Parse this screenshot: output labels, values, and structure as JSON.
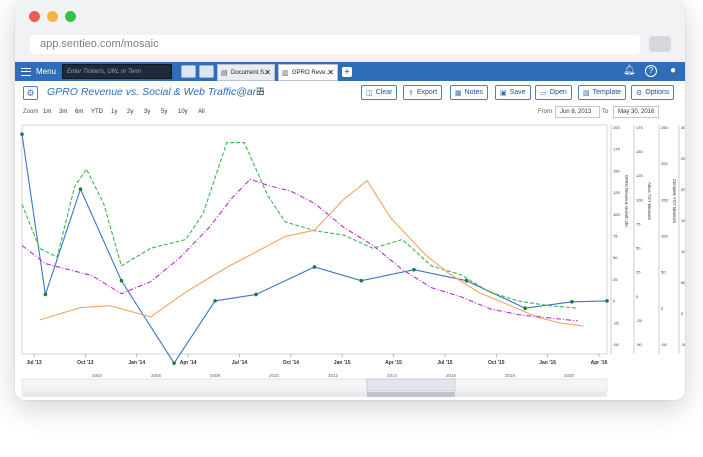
{
  "browser": {
    "url": "app.sentieo.com/mosaic",
    "dots": [
      "#ee5b52",
      "#f5b43f",
      "#38c14a"
    ]
  },
  "appbar": {
    "menu_label": "Menu",
    "ticker_placeholder": "Enter Ticker/s, URL or Term",
    "tabs": [
      {
        "label": "Document S..",
        "icon": "document-icon"
      },
      {
        "label": "GPRO Reve..",
        "icon": "chart-icon"
      }
    ],
    "new_tab_label": "+",
    "icons": [
      "bell-icon",
      "help-icon",
      "user-icon"
    ]
  },
  "toolbar": {
    "title": "GPRO Revenue vs. Social & Web Traffic@arib",
    "buttons": [
      {
        "label": "Clear",
        "icon": "clear-icon"
      },
      {
        "label": "Export",
        "icon": "export-icon"
      },
      {
        "label": "Notes",
        "icon": "notes-icon"
      },
      {
        "label": "Save",
        "icon": "save-icon"
      },
      {
        "label": "Open",
        "icon": "folder-icon"
      },
      {
        "label": "Template",
        "icon": "template-icon"
      },
      {
        "label": "Options",
        "icon": "gear-icon"
      }
    ]
  },
  "zoom": {
    "label": "Zoom",
    "options": [
      "1m",
      "3m",
      "6m",
      "YTD",
      "1y",
      "2y",
      "3y",
      "5y",
      "10y",
      "All"
    ],
    "from_label": "From",
    "from_value": "Jun 8, 2013",
    "to_label": "To",
    "to_value": "May 30, 2016"
  },
  "chart_data": {
    "type": "line",
    "x_ticks": [
      "Jul '13",
      "Oct '13",
      "Jan '14",
      "Apr '14",
      "Jul '14",
      "Oct '14",
      "Jan '15",
      "Apr '15",
      "Jul '15",
      "Oct '15",
      "Jan '16",
      "Apr '16"
    ],
    "navigator_ticks": [
      "2004",
      "2006",
      "2008",
      "2010",
      "2012",
      "2014",
      "2016",
      "2018",
      "2020"
    ],
    "axes": [
      {
        "label": "GPRO Revenue Growth.cbv",
        "ticks": [
          "200",
          "175",
          "150",
          "125",
          "100",
          "75",
          "50",
          "25",
          "0",
          "-25",
          "-50"
        ],
        "range": [
          -50,
          200
        ]
      },
      {
        "label": "Alexa YOY Measure",
        "ticks": [
          "175",
          "150",
          "125",
          "100",
          "75",
          "50",
          "25",
          "0",
          "-25",
          "-50"
        ],
        "range": [
          -60,
          200
        ]
      },
      {
        "label": "Compete YOY Measure",
        "ticks": [
          "250",
          "200",
          "150",
          "100",
          "50",
          "0",
          "-50"
        ],
        "range": [
          -70,
          300
        ]
      },
      {
        "label": "Twitter Mentions YOY Measure",
        "ticks": [
          "300",
          "250",
          "200",
          "150",
          "100",
          "50",
          "0",
          "-50"
        ],
        "range": [
          -60,
          320
        ]
      }
    ],
    "series": [
      {
        "name": "GPRO Revenue Growth.cbv",
        "color": "#3a78c4",
        "style": "solid-markers",
        "axis": 0,
        "points": [
          [
            0,
            190
          ],
          [
            0.4,
            15
          ],
          [
            1.0,
            130
          ],
          [
            1.7,
            30
          ],
          [
            2.6,
            -60
          ],
          [
            3.3,
            8
          ],
          [
            4.0,
            15
          ],
          [
            5.0,
            45
          ],
          [
            5.8,
            30
          ],
          [
            6.7,
            42
          ],
          [
            7.6,
            30
          ],
          [
            8.6,
            0
          ],
          [
            9.4,
            7
          ],
          [
            10.0,
            8
          ]
        ]
      },
      {
        "name": "Alexa YOY Measure",
        "color": "#3bb84b",
        "style": "dashed",
        "axis": 1,
        "points": [
          [
            0,
            110
          ],
          [
            0.3,
            60
          ],
          [
            0.6,
            50
          ],
          [
            0.9,
            130
          ],
          [
            1.1,
            150
          ],
          [
            1.4,
            110
          ],
          [
            1.7,
            40
          ],
          [
            2.2,
            60
          ],
          [
            2.8,
            70
          ],
          [
            3.1,
            100
          ],
          [
            3.5,
            180
          ],
          [
            3.8,
            180
          ],
          [
            4.2,
            120
          ],
          [
            4.5,
            90
          ],
          [
            5.0,
            80
          ],
          [
            5.5,
            75
          ],
          [
            6.0,
            60
          ],
          [
            6.5,
            70
          ],
          [
            7.0,
            40
          ],
          [
            7.5,
            30
          ],
          [
            8.0,
            10
          ],
          [
            8.5,
            0
          ],
          [
            9.0,
            -5
          ],
          [
            9.5,
            -8
          ]
        ]
      },
      {
        "name": "Compete YOY Measure",
        "color": "#f5a462",
        "style": "solid",
        "axis": 2,
        "points": [
          [
            0.3,
            -15
          ],
          [
            1.0,
            5
          ],
          [
            1.5,
            8
          ],
          [
            2.2,
            -10
          ],
          [
            2.8,
            30
          ],
          [
            3.5,
            70
          ],
          [
            4.5,
            120
          ],
          [
            5.0,
            130
          ],
          [
            5.5,
            180
          ],
          [
            5.9,
            210
          ],
          [
            6.3,
            150
          ],
          [
            6.9,
            90
          ],
          [
            7.3,
            60
          ],
          [
            7.8,
            30
          ],
          [
            8.3,
            10
          ],
          [
            8.8,
            -10
          ],
          [
            9.2,
            -20
          ],
          [
            9.6,
            -25
          ]
        ]
      },
      {
        "name": "Twitter Mentions YOY Measure",
        "color": "#c02ed0",
        "style": "dashdot",
        "axis": 3,
        "points": [
          [
            0,
            120
          ],
          [
            0.4,
            90
          ],
          [
            0.8,
            80
          ],
          [
            1.2,
            70
          ],
          [
            1.7,
            40
          ],
          [
            2.2,
            60
          ],
          [
            2.7,
            100
          ],
          [
            3.2,
            150
          ],
          [
            3.6,
            200
          ],
          [
            3.9,
            230
          ],
          [
            4.2,
            220
          ],
          [
            4.6,
            210
          ],
          [
            5.0,
            190
          ],
          [
            5.5,
            150
          ],
          [
            6.0,
            120
          ],
          [
            6.5,
            80
          ],
          [
            7.0,
            50
          ],
          [
            7.5,
            35
          ],
          [
            8.0,
            15
          ],
          [
            8.5,
            5
          ],
          [
            9.0,
            0
          ],
          [
            9.5,
            -5
          ]
        ]
      }
    ]
  }
}
